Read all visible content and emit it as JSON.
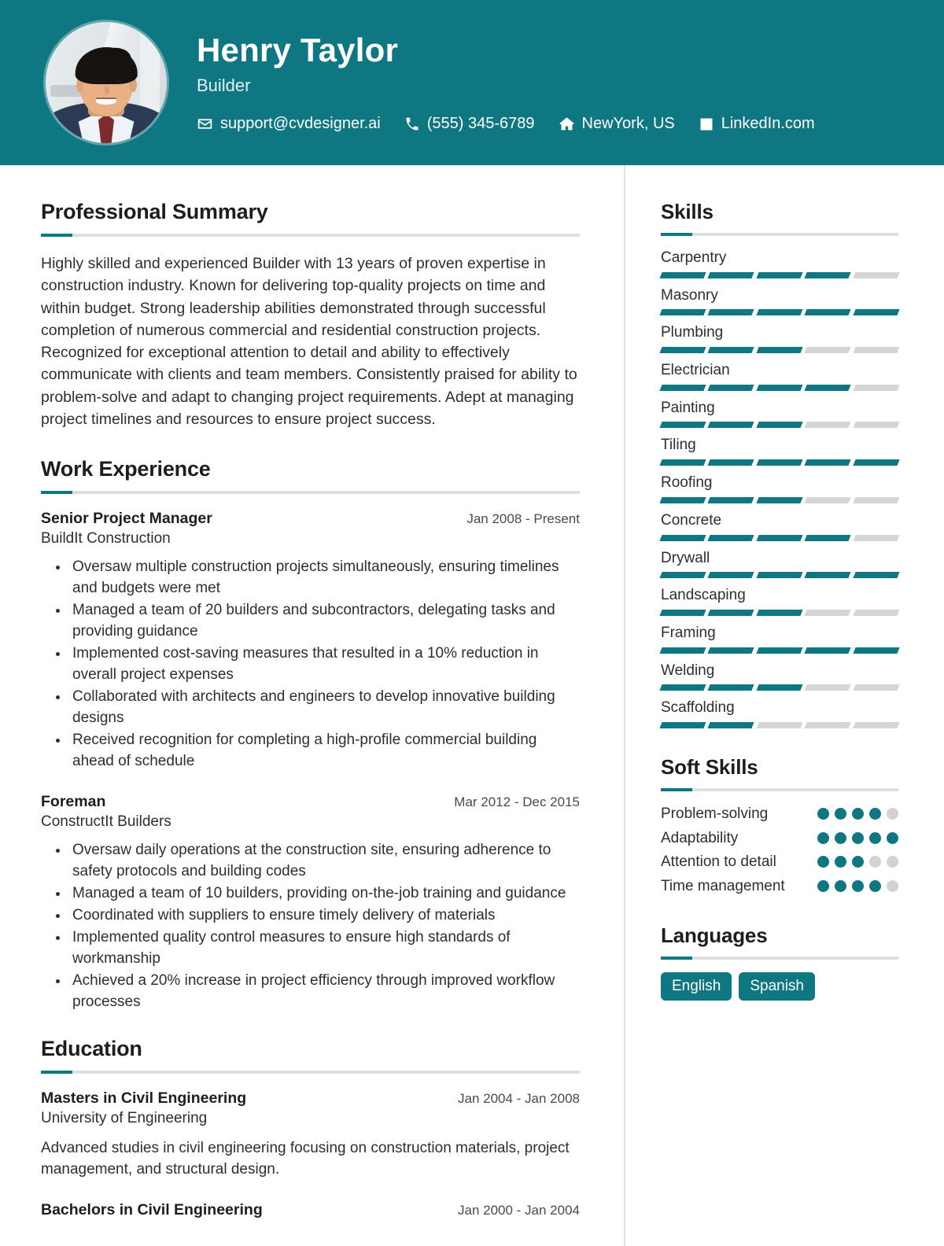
{
  "header": {
    "name": "Henry Taylor",
    "role": "Builder",
    "avatar_icon": "portrait-photo",
    "contacts": [
      {
        "icon": "envelope-icon",
        "label": "support@cvdesigner.ai"
      },
      {
        "icon": "phone-icon",
        "label": "(555) 345-6789"
      },
      {
        "icon": "home-icon",
        "label": "NewYork, US"
      },
      {
        "icon": "linkedin-icon",
        "label": "LinkedIn.com"
      }
    ]
  },
  "main": {
    "summary": {
      "title": "Professional Summary",
      "text": "Highly skilled and experienced Builder with 13 years of proven expertise in construction industry. Known for delivering top-quality projects on time and within budget. Strong leadership abilities demonstrated through successful completion of numerous commercial and residential construction projects. Recognized for exceptional attention to detail and ability to effectively communicate with clients and team members. Consistently praised for ability to problem-solve and adapt to changing project requirements. Adept at managing project timelines and resources to ensure project success."
    },
    "experience": {
      "title": "Work Experience",
      "entries": [
        {
          "role": "Senior Project Manager",
          "date": "Jan 2008 - Present",
          "company": "BuildIt Construction",
          "bullets": [
            "Oversaw multiple construction projects simultaneously, ensuring timelines and budgets were met",
            "Managed a team of 20 builders and subcontractors, delegating tasks and providing guidance",
            "Implemented cost-saving measures that resulted in a 10% reduction in overall project expenses",
            "Collaborated with architects and engineers to develop innovative building designs",
            "Received recognition for completing a high-profile commercial building ahead of schedule"
          ]
        },
        {
          "role": "Foreman",
          "date": "Mar 2012 - Dec 2015",
          "company": "ConstructIt Builders",
          "bullets": [
            "Oversaw daily operations at the construction site, ensuring adherence to safety protocols and building codes",
            "Managed a team of 10 builders, providing on-the-job training and guidance",
            "Coordinated with suppliers to ensure timely delivery of materials",
            "Implemented quality control measures to ensure high standards of workmanship",
            "Achieved a 20% increase in project efficiency through improved workflow processes"
          ]
        }
      ]
    },
    "education": {
      "title": "Education",
      "entries": [
        {
          "degree": "Masters in Civil Engineering",
          "date": "Jan 2004 - Jan 2008",
          "school": "University of Engineering",
          "description": "Advanced studies in civil engineering focusing on construction materials, project management, and structural design."
        },
        {
          "degree": "Bachelors in Civil Engineering",
          "date": "Jan 2000 - Jan 2004",
          "school": "",
          "description": ""
        }
      ]
    }
  },
  "sidebar": {
    "skills": {
      "title": "Skills",
      "max": 5,
      "items": [
        {
          "name": "Carpentry",
          "level": 4
        },
        {
          "name": "Masonry",
          "level": 5
        },
        {
          "name": "Plumbing",
          "level": 3
        },
        {
          "name": "Electrician",
          "level": 4
        },
        {
          "name": "Painting",
          "level": 3
        },
        {
          "name": "Tiling",
          "level": 5
        },
        {
          "name": "Roofing",
          "level": 3
        },
        {
          "name": "Concrete",
          "level": 4
        },
        {
          "name": "Drywall",
          "level": 5
        },
        {
          "name": "Landscaping",
          "level": 3
        },
        {
          "name": "Framing",
          "level": 5
        },
        {
          "name": "Welding",
          "level": 3
        },
        {
          "name": "Scaffolding",
          "level": 2
        }
      ]
    },
    "soft_skills": {
      "title": "Soft Skills",
      "max": 5,
      "items": [
        {
          "name": "Problem-solving",
          "level": 4
        },
        {
          "name": "Adaptability",
          "level": 5
        },
        {
          "name": "Attention to detail",
          "level": 3
        },
        {
          "name": "Time management",
          "level": 4
        }
      ]
    },
    "languages": {
      "title": "Languages",
      "items": [
        "English",
        "Spanish"
      ]
    }
  },
  "theme": {
    "accent": "#0e7781",
    "track": "#d5d5d5",
    "rule": "#dedede",
    "text": "#2e2e2e",
    "heading": "#1d1d1d"
  }
}
